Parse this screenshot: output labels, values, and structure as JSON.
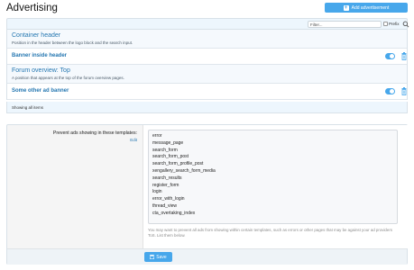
{
  "page": {
    "title": "Advertising"
  },
  "toolbar": {
    "add_label": "Add advertisement"
  },
  "filter": {
    "placeholder": "Filter...",
    "prefix_label": "Prefix"
  },
  "positions": [
    {
      "title": "Container header",
      "description": "Position in the header between the logo block and the search input.",
      "ads": [
        {
          "title": "Banner inside header",
          "enabled": true
        }
      ]
    },
    {
      "title": "Forum overview: Top",
      "description": "A position that appears at the top of the forum overview pages.",
      "ads": [
        {
          "title": "Some other ad banner",
          "enabled": true
        }
      ]
    }
  ],
  "footer": {
    "status": "Showing all items"
  },
  "form": {
    "label": "Prevent ads showing in these templates:",
    "edit_label": "Edit",
    "templates": [
      "error",
      "message_page",
      "search_form",
      "search_form_post",
      "search_form_profile_post",
      "xengallery_search_form_media",
      "search_results",
      "register_form",
      "login",
      "error_with_login",
      "thread_view",
      "cta_overtaking_index"
    ],
    "hint": "You may want to prevent all ads from showing within certain templates, such as errors or other pages that may be against your ad providers ToS. List them below.",
    "save_label": "Save"
  },
  "colors": {
    "accent": "#47a7eb",
    "link": "#2577b1"
  }
}
